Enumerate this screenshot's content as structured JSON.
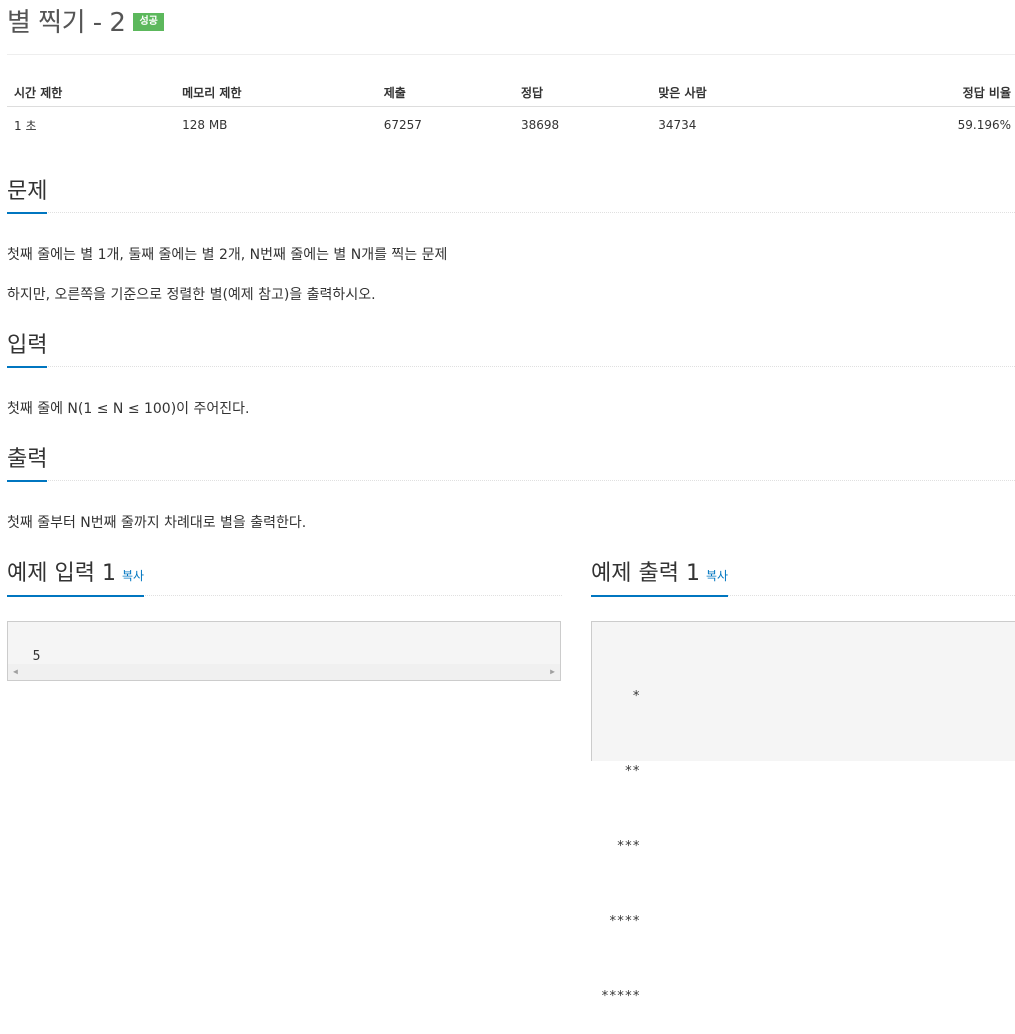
{
  "problem": {
    "title": "별 찍기 - 2",
    "badge": "성공"
  },
  "info": {
    "headers": [
      "시간 제한",
      "메모리 제한",
      "제출",
      "정답",
      "맞은 사람",
      "정답 비율"
    ],
    "values": [
      "1 초",
      "128 MB",
      "67257",
      "38698",
      "34734",
      "59.196%"
    ]
  },
  "sections": {
    "description": {
      "title": "문제",
      "lines": [
        "첫째 줄에는 별 1개, 둘째 줄에는 별 2개, N번째 줄에는 별 N개를 찍는 문제",
        "하지만, 오른쪽을 기준으로 정렬한 별(예제 참고)을 출력하시오."
      ]
    },
    "input": {
      "title": "입력",
      "lines": [
        "첫째 줄에 N(1 ≤ N ≤ 100)이 주어진다."
      ]
    },
    "output": {
      "title": "출력",
      "lines": [
        "첫째 줄부터 N번째 줄까지 차례대로 별을 출력한다."
      ]
    }
  },
  "examples": {
    "input": {
      "title": "예제 입력 1",
      "copy": "복사",
      "content": "5"
    },
    "output": {
      "title": "예제 출력 1",
      "copy": "복사",
      "lines": [
        "    *",
        "   **",
        "  ***",
        " ****",
        "*****"
      ]
    }
  },
  "icons": {
    "scroll_left": "◀",
    "scroll_right": "▶"
  },
  "colors": {
    "accent": "#0076c0",
    "success": "#5cb85c"
  }
}
